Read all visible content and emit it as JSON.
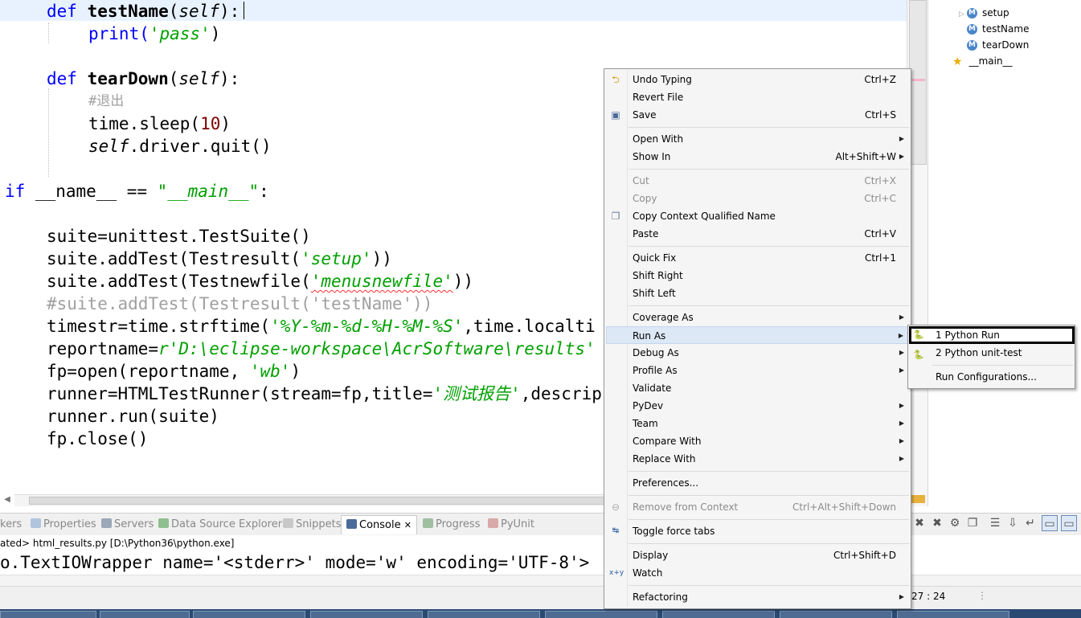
{
  "editor": {
    "lines": {
      "l1": {
        "def": "def ",
        "name": "testName",
        "open": "(",
        "self": "self",
        "close": "):"
      },
      "l2": {
        "fn": "print(",
        "str": "'pass'",
        "close": ")"
      },
      "l3": {
        "def": "def ",
        "name": "tearDown",
        "open": "(",
        "self": "self",
        "close": "):"
      },
      "l4": {
        "comment": "#退出"
      },
      "l5": {
        "code": "time.sleep(",
        "num": "10",
        "close": ")"
      },
      "l6": {
        "self": "self",
        "code": ".driver.quit()"
      },
      "l7": {
        "kw": "if",
        "code": " __name__ == ",
        "str": "\"__main__\"",
        "close": ":"
      },
      "l8": {
        "code": "suite=unittest.TestSuite()"
      },
      "l9": {
        "code": "suite.addTest(Testresult(",
        "str": "'setup'",
        "close": "))"
      },
      "l10": {
        "code": "suite.addTest(Testnewfile(",
        "str": "'menusnewfile'",
        "close": "))"
      },
      "l11": {
        "comment": "#suite.addTest(Testresult('testName'))"
      },
      "l12": {
        "code": "timestr=time.strftime(",
        "str": "'%Y-%m-%d-%H-%M-%S'",
        "close": ",time.localti"
      },
      "l13": {
        "code": "reportname=",
        "str": "r'D:\\eclipse-workspace\\AcrSoftware\\results'"
      },
      "l14": {
        "code": "fp=open(reportname, ",
        "str": "'wb'",
        "close": ")"
      },
      "l15": {
        "code": "runner=HTMLTestRunner(stream=fp,title=",
        "str": "'测试报告'",
        "close": ",descrip"
      },
      "l16": {
        "code": "runner.run(suite)"
      },
      "l17": {
        "code": "fp.close()"
      }
    }
  },
  "outline": {
    "items": [
      {
        "label": "setup",
        "icon": "method-icon"
      },
      {
        "label": "testName",
        "icon": "method-icon"
      },
      {
        "label": "tearDown",
        "icon": "method-icon"
      },
      {
        "label": "__main__",
        "icon": "star-icon"
      }
    ]
  },
  "panel": {
    "tabs": [
      "kers",
      "Properties",
      "Servers",
      "Data Source Explorer",
      "Snippets",
      "Console",
      "Progress",
      "PyUnit"
    ],
    "console_close": "✕",
    "console_header": "ated> html_results.py [D:\\Python36\\python.exe]",
    "console_output": "o.TextIOWrapper name='<stderr>' mode='w' encoding='UTF-8'>"
  },
  "status": {
    "position": "27 : 24"
  },
  "context_menu": {
    "items": [
      {
        "label": "Undo Typing",
        "shortcut": "Ctrl+Z",
        "icon": "undo-icon"
      },
      {
        "label": "Revert File",
        "shortcut": ""
      },
      {
        "label": "Save",
        "shortcut": "Ctrl+S",
        "icon": "save-icon"
      },
      {
        "label": "Open With",
        "shortcut": ""
      },
      {
        "label": "Show In",
        "shortcut": "Alt+Shift+W"
      },
      {
        "label": "Cut",
        "shortcut": "Ctrl+X"
      },
      {
        "label": "Copy",
        "shortcut": "Ctrl+C"
      },
      {
        "label": "Copy Context Qualified Name",
        "shortcut": "",
        "icon": "copy-qualified-icon"
      },
      {
        "label": "Paste",
        "shortcut": "Ctrl+V"
      },
      {
        "label": "Quick Fix",
        "shortcut": "Ctrl+1"
      },
      {
        "label": "Shift Right",
        "shortcut": ""
      },
      {
        "label": "Shift Left",
        "shortcut": ""
      },
      {
        "label": "Coverage As",
        "shortcut": ""
      },
      {
        "label": "Run As",
        "shortcut": ""
      },
      {
        "label": "Debug As",
        "shortcut": ""
      },
      {
        "label": "Profile As",
        "shortcut": ""
      },
      {
        "label": "Validate",
        "shortcut": ""
      },
      {
        "label": "PyDev",
        "shortcut": ""
      },
      {
        "label": "Team",
        "shortcut": ""
      },
      {
        "label": "Compare With",
        "shortcut": ""
      },
      {
        "label": "Replace With",
        "shortcut": ""
      },
      {
        "label": "Preferences...",
        "shortcut": ""
      },
      {
        "label": "Remove from Context",
        "shortcut": "Ctrl+Alt+Shift+Down",
        "icon": "remove-context-icon"
      },
      {
        "label": "Toggle force tabs",
        "shortcut": "",
        "icon": "toggle-tabs-icon"
      },
      {
        "label": "Display",
        "shortcut": "Ctrl+Shift+D"
      },
      {
        "label": "Watch",
        "shortcut": "",
        "icon": "watch-icon"
      },
      {
        "label": "Refactoring",
        "shortcut": ""
      }
    ]
  },
  "submenu": {
    "items": [
      {
        "label": "1 Python Run",
        "icon": "python-run-icon"
      },
      {
        "label": "2 Python unit-test",
        "icon": "python-unittest-icon"
      },
      {
        "label": "Run Configurations..."
      }
    ]
  }
}
